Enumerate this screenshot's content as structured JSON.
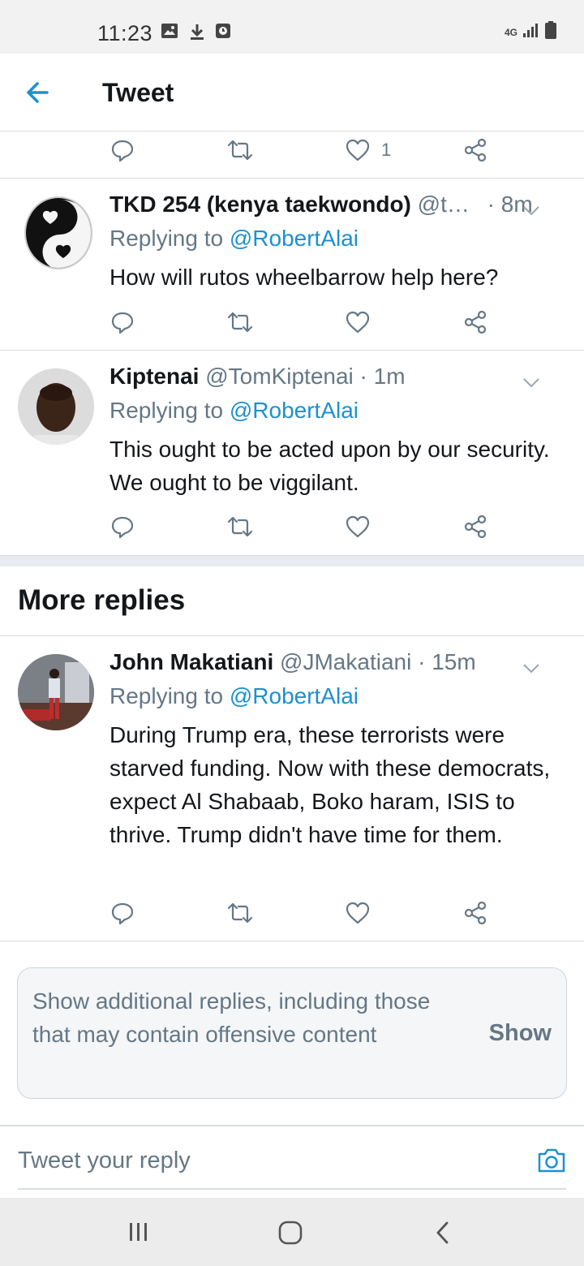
{
  "status_bar": {
    "time": "11:23",
    "network": "4G"
  },
  "header": {
    "title": "Tweet"
  },
  "top_actions": {
    "like_count": "1"
  },
  "tweets": [
    {
      "name": "TKD 254 (kenya taekwondo)",
      "handle": "@t…",
      "time": "· 8m",
      "replying_label": "Replying to ",
      "replying_to": "@RobertAlai",
      "text": "How will rutos wheelbarrow help here?"
    },
    {
      "name": "Kiptenai",
      "handle": "@TomKiptenai",
      "time": "· 1m",
      "replying_label": "Replying to ",
      "replying_to": "@RobertAlai",
      "text": "This ought to be acted upon by our security. We ought to be viggilant."
    },
    {
      "name": "John Makatiani",
      "handle": "@JMakatiani",
      "time": "· 15m",
      "replying_label": "Replying to ",
      "replying_to": "@RobertAlai",
      "text": "During Trump era, these terrorists were starved funding. Now with these democrats, expect Al Shabaab, Boko haram, ISIS to thrive. Trump didn't have time for them."
    }
  ],
  "more_replies": {
    "title": "More replies"
  },
  "additional": {
    "text": "Show additional replies, including those that may contain offensive content",
    "button": "Show"
  },
  "reply": {
    "placeholder": "Tweet your reply"
  },
  "colors": {
    "accent": "#1d90d0",
    "secondary": "#657786",
    "text": "#14171a"
  }
}
